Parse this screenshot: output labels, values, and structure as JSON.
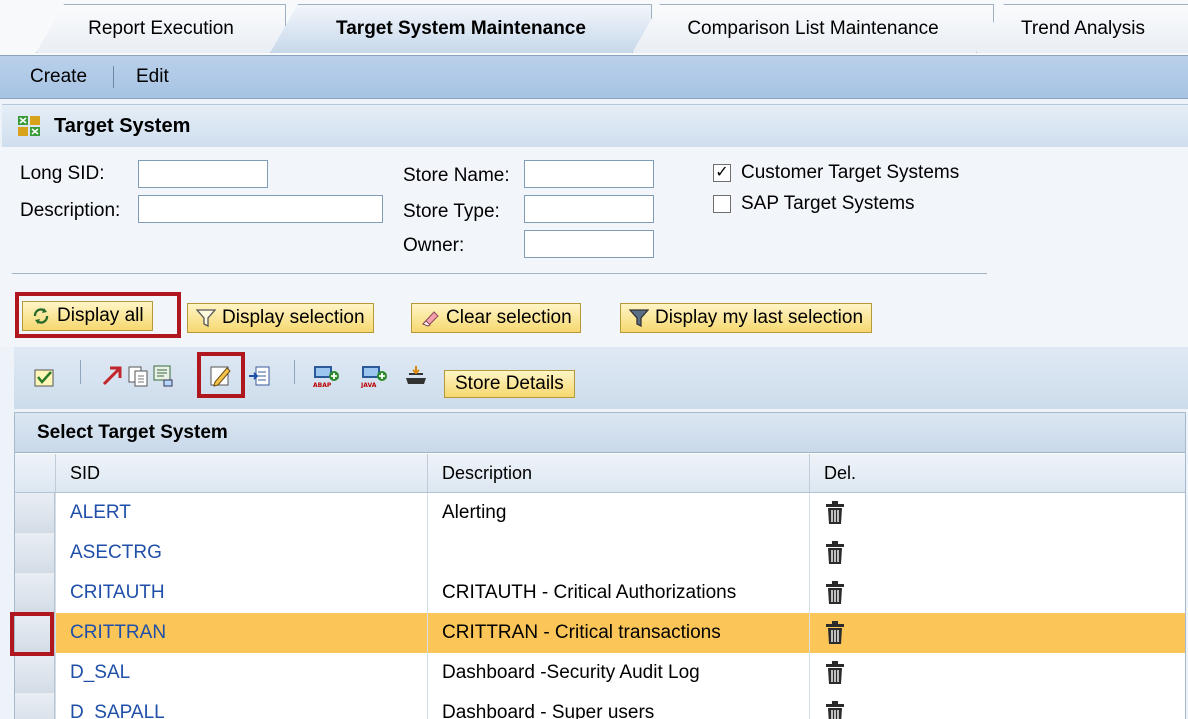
{
  "tabs": [
    {
      "label": "Report Execution",
      "active": false
    },
    {
      "label": "Target System Maintenance",
      "active": true
    },
    {
      "label": "Comparison List Maintenance",
      "active": false
    },
    {
      "label": "Trend Analysis",
      "active": false
    }
  ],
  "menu": {
    "create": "Create",
    "edit": "Edit"
  },
  "panel": {
    "title": "Target System",
    "icon": "target-system-icon"
  },
  "form": {
    "long_sid_label": "Long SID:",
    "long_sid_value": "",
    "description_label": "Description:",
    "description_value": "",
    "store_name_label": "Store Name:",
    "store_name_value": "",
    "store_type_label": "Store Type:",
    "store_type_value": "",
    "owner_label": "Owner:",
    "owner_value": "",
    "customer_target_label": "Customer Target Systems",
    "customer_target_checked": true,
    "sap_target_label": "SAP Target Systems",
    "sap_target_checked": false
  },
  "buttons": {
    "display_all": "Display all",
    "display_selection": "Display selection",
    "clear_selection": "Clear selection",
    "display_last": "Display my last selection"
  },
  "toolbar": {
    "store_details": "Store Details"
  },
  "table": {
    "title": "Select Target System",
    "columns": [
      "SID",
      "Description",
      "Del."
    ],
    "rows": [
      {
        "sid": "ALERT",
        "description": "Alerting",
        "selected": false
      },
      {
        "sid": "ASECTRG",
        "description": "",
        "selected": false
      },
      {
        "sid": "CRITAUTH",
        "description": "CRITAUTH - Critical Authorizations",
        "selected": false
      },
      {
        "sid": "CRITTRAN",
        "description": "CRITTRAN - Critical transactions",
        "selected": true
      },
      {
        "sid": "D_SAL",
        "description": "Dashboard -Security Audit Log",
        "selected": false
      },
      {
        "sid": "D_SAPALL",
        "description": "Dashboard - Super users",
        "selected": false
      }
    ]
  },
  "colors": {
    "selected_row": "#fbc558",
    "highlight_frame": "#b0161d",
    "link_text": "#1f4fa8",
    "button_fill": "#f6d86f"
  }
}
